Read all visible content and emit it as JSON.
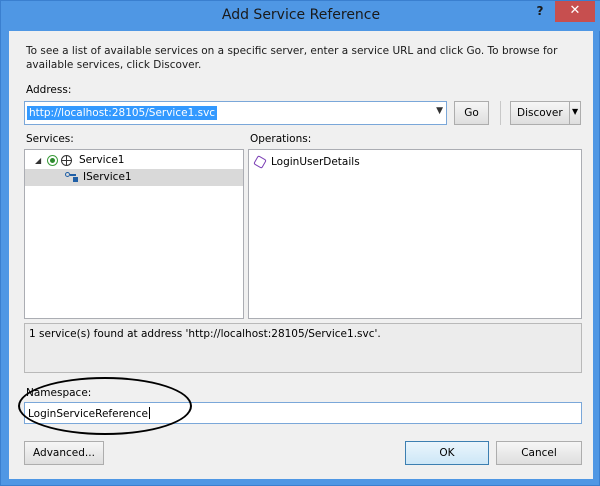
{
  "window": {
    "title": "Add Service Reference",
    "help_label": "?",
    "close_label": "✕"
  },
  "description": "To see a list of available services on a specific server, enter a service URL and click Go. To browse for available services, click Discover.",
  "address": {
    "label": "Address:",
    "value": "http://localhost:28105/Service1.svc"
  },
  "buttons": {
    "go": "Go",
    "discover": "Discover",
    "advanced": "Advanced...",
    "ok": "OK",
    "cancel": "Cancel"
  },
  "services": {
    "label": "Services:",
    "items": [
      {
        "label": "Service1",
        "icon": "globe-icon",
        "expanded": true
      },
      {
        "label": "IService1",
        "icon": "interface-icon",
        "selected": true
      }
    ]
  },
  "operations": {
    "label": "Operations:",
    "items": [
      {
        "label": "LoginUserDetails",
        "icon": "method-icon"
      }
    ]
  },
  "status": "1 service(s) found at address 'http://localhost:28105/Service1.svc'.",
  "namespace": {
    "label": "Namespace:",
    "value": "LoginServiceReference"
  },
  "colors": {
    "title_bar": "#4f97e4",
    "close_button": "#c74f4f",
    "selection": "#3399ff"
  }
}
